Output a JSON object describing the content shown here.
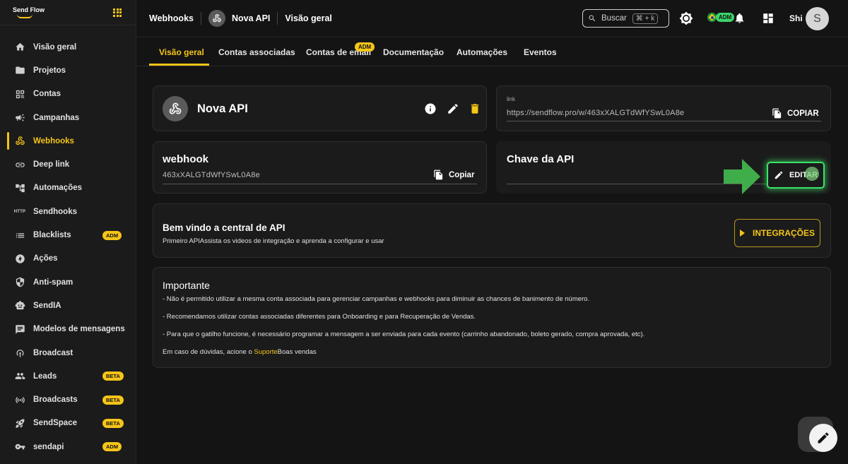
{
  "brand": {
    "name": "Send Flow"
  },
  "sidebar": {
    "items": [
      {
        "label": "Visão geral",
        "icon": "home-icon"
      },
      {
        "label": "Projetos",
        "icon": "folder-icon"
      },
      {
        "label": "Contas",
        "icon": "qr-icon"
      },
      {
        "label": "Campanhas",
        "icon": "megaphone-icon"
      },
      {
        "label": "Webhooks",
        "icon": "webhook-icon",
        "active": true
      },
      {
        "label": "Deep link",
        "icon": "link-icon"
      },
      {
        "label": "Automações",
        "icon": "automation-icon"
      },
      {
        "label": "Sendhooks",
        "icon": "http-icon",
        "icon_text": "HTTP"
      },
      {
        "label": "Blacklists",
        "icon": "list-icon",
        "badge": "ADM"
      },
      {
        "label": "Ações",
        "icon": "bolt-icon"
      },
      {
        "label": "Anti-spam",
        "icon": "shield-icon"
      },
      {
        "label": "SendIA",
        "icon": "robot-icon"
      },
      {
        "label": "Modelos de mensagens",
        "icon": "message-icon"
      },
      {
        "label": "Broadcast",
        "icon": "broadcast-icon"
      },
      {
        "label": "Leads",
        "icon": "people-icon",
        "badge": "BETA"
      },
      {
        "label": "Broadcasts",
        "icon": "antenna-icon",
        "badge": "BETA"
      },
      {
        "label": "SendSpace",
        "icon": "rocket-icon",
        "badge": "BETA"
      },
      {
        "label": "sendapi",
        "icon": "key-icon",
        "badge": "ADM"
      }
    ]
  },
  "topbar": {
    "section": "Webhooks",
    "api_name": "Nova API",
    "page": "Visão geral",
    "search_label": "Buscar",
    "search_shortcut": "⌘ + k",
    "adm_badge": "ADM",
    "user_name": "Shi",
    "user_initial": "S"
  },
  "tabs": [
    {
      "label": "Visão geral",
      "active": true
    },
    {
      "label": "Contas associadas"
    },
    {
      "label": "Contas de email",
      "badge": "ADM"
    },
    {
      "label": "Documentação"
    },
    {
      "label": "Automações"
    },
    {
      "label": "Eventos"
    }
  ],
  "api_card": {
    "title": "Nova API"
  },
  "link_card": {
    "label": "link",
    "value": "https://sendflow.pro/w/463xXALGTdWfYSwL0A8e",
    "copy_label": "COPIAR"
  },
  "webhook_card": {
    "title": "webhook",
    "value": "463xXALGTdWfYSwL0A8e",
    "copy_label": "Copiar"
  },
  "api_key_card": {
    "title": "Chave da API",
    "edit_label": "EDITAR"
  },
  "welcome": {
    "title": "Bem vindo a central de API",
    "subtitle": "Primeiro APIAssista os videos de integração e aprenda a configurar e usar",
    "button_label": "INTEGRAÇÕES"
  },
  "important": {
    "title": "Importante",
    "lines": [
      "- Não é permitido utilizar a mesma conta associada para gerenciar campanhas e webhooks para diminuir as chances de banimento de número.",
      "- Recomendamos utilizar contas associadas diferentes para Onboarding e para Recuperação de Vendas.",
      "- Para que o gatilho funcione, é necessário programar a mensagem a ser enviada para cada evento (carrinho abandonado, boleto gerado, compra aprovada, etc)."
    ],
    "help_prefix": "Em caso de dúvidas, acione o ",
    "help_link": "Suporte",
    "help_suffix": "Boas vendas"
  },
  "colors": {
    "accent": "#f5c518",
    "highlight": "#3be36a",
    "background": "#141414",
    "card": "#1b1b1b"
  }
}
